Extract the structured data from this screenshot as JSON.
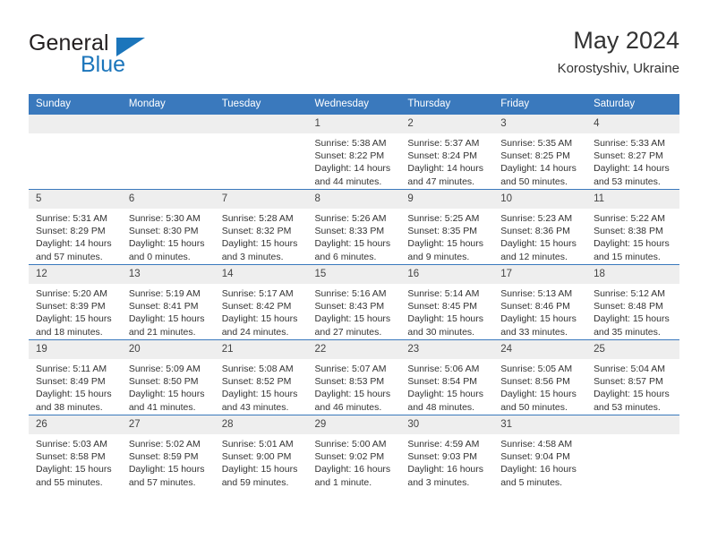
{
  "brand": {
    "word_one": "General",
    "word_two": "Blue",
    "triangle_icon": "triangle-icon",
    "accent_color": "#1b75bb"
  },
  "header": {
    "title": "May 2024",
    "subtitle": "Korostyshiv, Ukraine"
  },
  "theme": {
    "header_band": "#3a79bd",
    "daynum_band": "#eeeeee",
    "text": "#333333"
  },
  "weekdays": [
    "Sunday",
    "Monday",
    "Tuesday",
    "Wednesday",
    "Thursday",
    "Friday",
    "Saturday"
  ],
  "weeks": [
    [
      {
        "day": "",
        "empty": true,
        "sunrise": "",
        "sunset": "",
        "daylight_1": "",
        "daylight_2": ""
      },
      {
        "day": "",
        "empty": true,
        "sunrise": "",
        "sunset": "",
        "daylight_1": "",
        "daylight_2": ""
      },
      {
        "day": "",
        "empty": true,
        "sunrise": "",
        "sunset": "",
        "daylight_1": "",
        "daylight_2": ""
      },
      {
        "day": "1",
        "empty": false,
        "sunrise": "Sunrise: 5:38 AM",
        "sunset": "Sunset: 8:22 PM",
        "daylight_1": "Daylight: 14 hours",
        "daylight_2": "and 44 minutes."
      },
      {
        "day": "2",
        "empty": false,
        "sunrise": "Sunrise: 5:37 AM",
        "sunset": "Sunset: 8:24 PM",
        "daylight_1": "Daylight: 14 hours",
        "daylight_2": "and 47 minutes."
      },
      {
        "day": "3",
        "empty": false,
        "sunrise": "Sunrise: 5:35 AM",
        "sunset": "Sunset: 8:25 PM",
        "daylight_1": "Daylight: 14 hours",
        "daylight_2": "and 50 minutes."
      },
      {
        "day": "4",
        "empty": false,
        "sunrise": "Sunrise: 5:33 AM",
        "sunset": "Sunset: 8:27 PM",
        "daylight_1": "Daylight: 14 hours",
        "daylight_2": "and 53 minutes."
      }
    ],
    [
      {
        "day": "5",
        "empty": false,
        "sunrise": "Sunrise: 5:31 AM",
        "sunset": "Sunset: 8:29 PM",
        "daylight_1": "Daylight: 14 hours",
        "daylight_2": "and 57 minutes."
      },
      {
        "day": "6",
        "empty": false,
        "sunrise": "Sunrise: 5:30 AM",
        "sunset": "Sunset: 8:30 PM",
        "daylight_1": "Daylight: 15 hours",
        "daylight_2": "and 0 minutes."
      },
      {
        "day": "7",
        "empty": false,
        "sunrise": "Sunrise: 5:28 AM",
        "sunset": "Sunset: 8:32 PM",
        "daylight_1": "Daylight: 15 hours",
        "daylight_2": "and 3 minutes."
      },
      {
        "day": "8",
        "empty": false,
        "sunrise": "Sunrise: 5:26 AM",
        "sunset": "Sunset: 8:33 PM",
        "daylight_1": "Daylight: 15 hours",
        "daylight_2": "and 6 minutes."
      },
      {
        "day": "9",
        "empty": false,
        "sunrise": "Sunrise: 5:25 AM",
        "sunset": "Sunset: 8:35 PM",
        "daylight_1": "Daylight: 15 hours",
        "daylight_2": "and 9 minutes."
      },
      {
        "day": "10",
        "empty": false,
        "sunrise": "Sunrise: 5:23 AM",
        "sunset": "Sunset: 8:36 PM",
        "daylight_1": "Daylight: 15 hours",
        "daylight_2": "and 12 minutes."
      },
      {
        "day": "11",
        "empty": false,
        "sunrise": "Sunrise: 5:22 AM",
        "sunset": "Sunset: 8:38 PM",
        "daylight_1": "Daylight: 15 hours",
        "daylight_2": "and 15 minutes."
      }
    ],
    [
      {
        "day": "12",
        "empty": false,
        "sunrise": "Sunrise: 5:20 AM",
        "sunset": "Sunset: 8:39 PM",
        "daylight_1": "Daylight: 15 hours",
        "daylight_2": "and 18 minutes."
      },
      {
        "day": "13",
        "empty": false,
        "sunrise": "Sunrise: 5:19 AM",
        "sunset": "Sunset: 8:41 PM",
        "daylight_1": "Daylight: 15 hours",
        "daylight_2": "and 21 minutes."
      },
      {
        "day": "14",
        "empty": false,
        "sunrise": "Sunrise: 5:17 AM",
        "sunset": "Sunset: 8:42 PM",
        "daylight_1": "Daylight: 15 hours",
        "daylight_2": "and 24 minutes."
      },
      {
        "day": "15",
        "empty": false,
        "sunrise": "Sunrise: 5:16 AM",
        "sunset": "Sunset: 8:43 PM",
        "daylight_1": "Daylight: 15 hours",
        "daylight_2": "and 27 minutes."
      },
      {
        "day": "16",
        "empty": false,
        "sunrise": "Sunrise: 5:14 AM",
        "sunset": "Sunset: 8:45 PM",
        "daylight_1": "Daylight: 15 hours",
        "daylight_2": "and 30 minutes."
      },
      {
        "day": "17",
        "empty": false,
        "sunrise": "Sunrise: 5:13 AM",
        "sunset": "Sunset: 8:46 PM",
        "daylight_1": "Daylight: 15 hours",
        "daylight_2": "and 33 minutes."
      },
      {
        "day": "18",
        "empty": false,
        "sunrise": "Sunrise: 5:12 AM",
        "sunset": "Sunset: 8:48 PM",
        "daylight_1": "Daylight: 15 hours",
        "daylight_2": "and 35 minutes."
      }
    ],
    [
      {
        "day": "19",
        "empty": false,
        "sunrise": "Sunrise: 5:11 AM",
        "sunset": "Sunset: 8:49 PM",
        "daylight_1": "Daylight: 15 hours",
        "daylight_2": "and 38 minutes."
      },
      {
        "day": "20",
        "empty": false,
        "sunrise": "Sunrise: 5:09 AM",
        "sunset": "Sunset: 8:50 PM",
        "daylight_1": "Daylight: 15 hours",
        "daylight_2": "and 41 minutes."
      },
      {
        "day": "21",
        "empty": false,
        "sunrise": "Sunrise: 5:08 AM",
        "sunset": "Sunset: 8:52 PM",
        "daylight_1": "Daylight: 15 hours",
        "daylight_2": "and 43 minutes."
      },
      {
        "day": "22",
        "empty": false,
        "sunrise": "Sunrise: 5:07 AM",
        "sunset": "Sunset: 8:53 PM",
        "daylight_1": "Daylight: 15 hours",
        "daylight_2": "and 46 minutes."
      },
      {
        "day": "23",
        "empty": false,
        "sunrise": "Sunrise: 5:06 AM",
        "sunset": "Sunset: 8:54 PM",
        "daylight_1": "Daylight: 15 hours",
        "daylight_2": "and 48 minutes."
      },
      {
        "day": "24",
        "empty": false,
        "sunrise": "Sunrise: 5:05 AM",
        "sunset": "Sunset: 8:56 PM",
        "daylight_1": "Daylight: 15 hours",
        "daylight_2": "and 50 minutes."
      },
      {
        "day": "25",
        "empty": false,
        "sunrise": "Sunrise: 5:04 AM",
        "sunset": "Sunset: 8:57 PM",
        "daylight_1": "Daylight: 15 hours",
        "daylight_2": "and 53 minutes."
      }
    ],
    [
      {
        "day": "26",
        "empty": false,
        "sunrise": "Sunrise: 5:03 AM",
        "sunset": "Sunset: 8:58 PM",
        "daylight_1": "Daylight: 15 hours",
        "daylight_2": "and 55 minutes."
      },
      {
        "day": "27",
        "empty": false,
        "sunrise": "Sunrise: 5:02 AM",
        "sunset": "Sunset: 8:59 PM",
        "daylight_1": "Daylight: 15 hours",
        "daylight_2": "and 57 minutes."
      },
      {
        "day": "28",
        "empty": false,
        "sunrise": "Sunrise: 5:01 AM",
        "sunset": "Sunset: 9:00 PM",
        "daylight_1": "Daylight: 15 hours",
        "daylight_2": "and 59 minutes."
      },
      {
        "day": "29",
        "empty": false,
        "sunrise": "Sunrise: 5:00 AM",
        "sunset": "Sunset: 9:02 PM",
        "daylight_1": "Daylight: 16 hours",
        "daylight_2": "and 1 minute."
      },
      {
        "day": "30",
        "empty": false,
        "sunrise": "Sunrise: 4:59 AM",
        "sunset": "Sunset: 9:03 PM",
        "daylight_1": "Daylight: 16 hours",
        "daylight_2": "and 3 minutes."
      },
      {
        "day": "31",
        "empty": false,
        "sunrise": "Sunrise: 4:58 AM",
        "sunset": "Sunset: 9:04 PM",
        "daylight_1": "Daylight: 16 hours",
        "daylight_2": "and 5 minutes."
      },
      {
        "day": "",
        "empty": true,
        "sunrise": "",
        "sunset": "",
        "daylight_1": "",
        "daylight_2": ""
      }
    ]
  ]
}
